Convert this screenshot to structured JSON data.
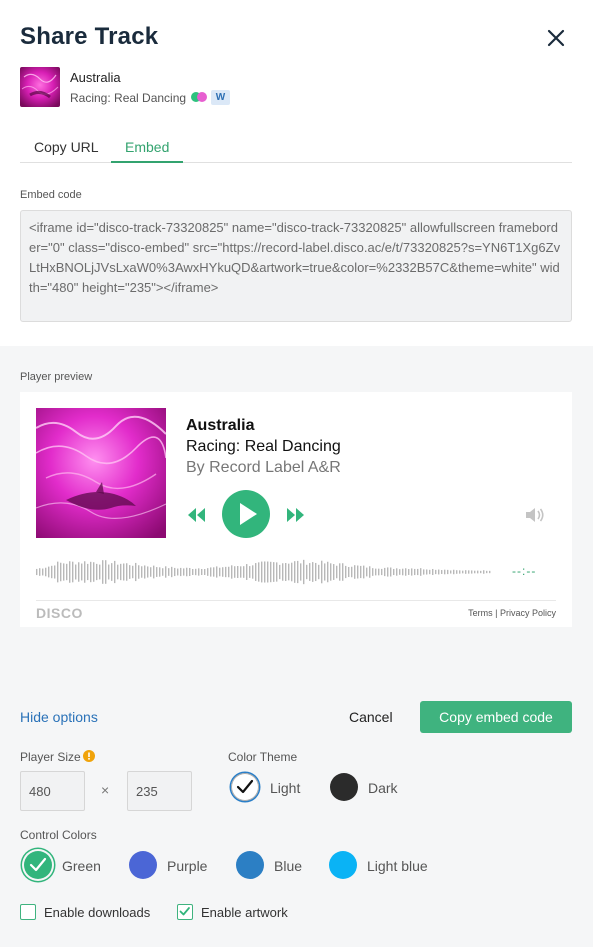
{
  "dialog": {
    "title": "Share Track"
  },
  "track": {
    "name": "Australia",
    "album": "Racing: Real Dancing",
    "badge": "W"
  },
  "tabs": [
    {
      "label": "Copy URL",
      "active": false
    },
    {
      "label": "Embed",
      "active": true
    }
  ],
  "embed": {
    "label": "Embed code",
    "code": "<iframe id=\"disco-track-73320825\" name=\"disco-track-73320825\" allowfullscreen frameborder=\"0\" class=\"disco-embed\" src=\"https://record-label.disco.ac/e/t/73320825?s=YN6T1Xg6ZvLtHxBNOLjJVsLxaW0%3AwxHYkuQD&artwork=true&color=%2332B57C&theme=white\" width=\"480\" height=\"235\"></iframe>"
  },
  "preview": {
    "label": "Player preview",
    "title": "Australia",
    "album": "Racing: Real Dancing",
    "artist": "By Record Label A&R",
    "time": "--:--",
    "brand": "DISCO",
    "terms": "Terms | Privacy Policy"
  },
  "actions": {
    "hide_options": "Hide options",
    "cancel": "Cancel",
    "copy": "Copy embed code"
  },
  "options": {
    "player_size_label": "Player Size",
    "width": "480",
    "height": "235",
    "times": "×",
    "color_theme_label": "Color Theme",
    "themes": [
      {
        "label": "Light",
        "color": "#ffffff",
        "selected": true
      },
      {
        "label": "Dark",
        "color": "#2b2b2b",
        "selected": false
      }
    ],
    "control_colors_label": "Control Colors",
    "colors": [
      {
        "label": "Green",
        "color": "#32b57c",
        "selected": true
      },
      {
        "label": "Purple",
        "color": "#4b66d6",
        "selected": false
      },
      {
        "label": "Blue",
        "color": "#2c7fc4",
        "selected": false
      },
      {
        "label": "Light blue",
        "color": "#0ab3f5",
        "selected": false
      }
    ],
    "enable_downloads": {
      "label": "Enable downloads",
      "checked": false
    },
    "enable_artwork": {
      "label": "Enable artwork",
      "checked": true
    }
  },
  "icons": [
    "close-icon",
    "play-icon",
    "rewind-icon",
    "fast-forward-icon",
    "volume-icon",
    "info-icon",
    "checkmark-icon"
  ]
}
